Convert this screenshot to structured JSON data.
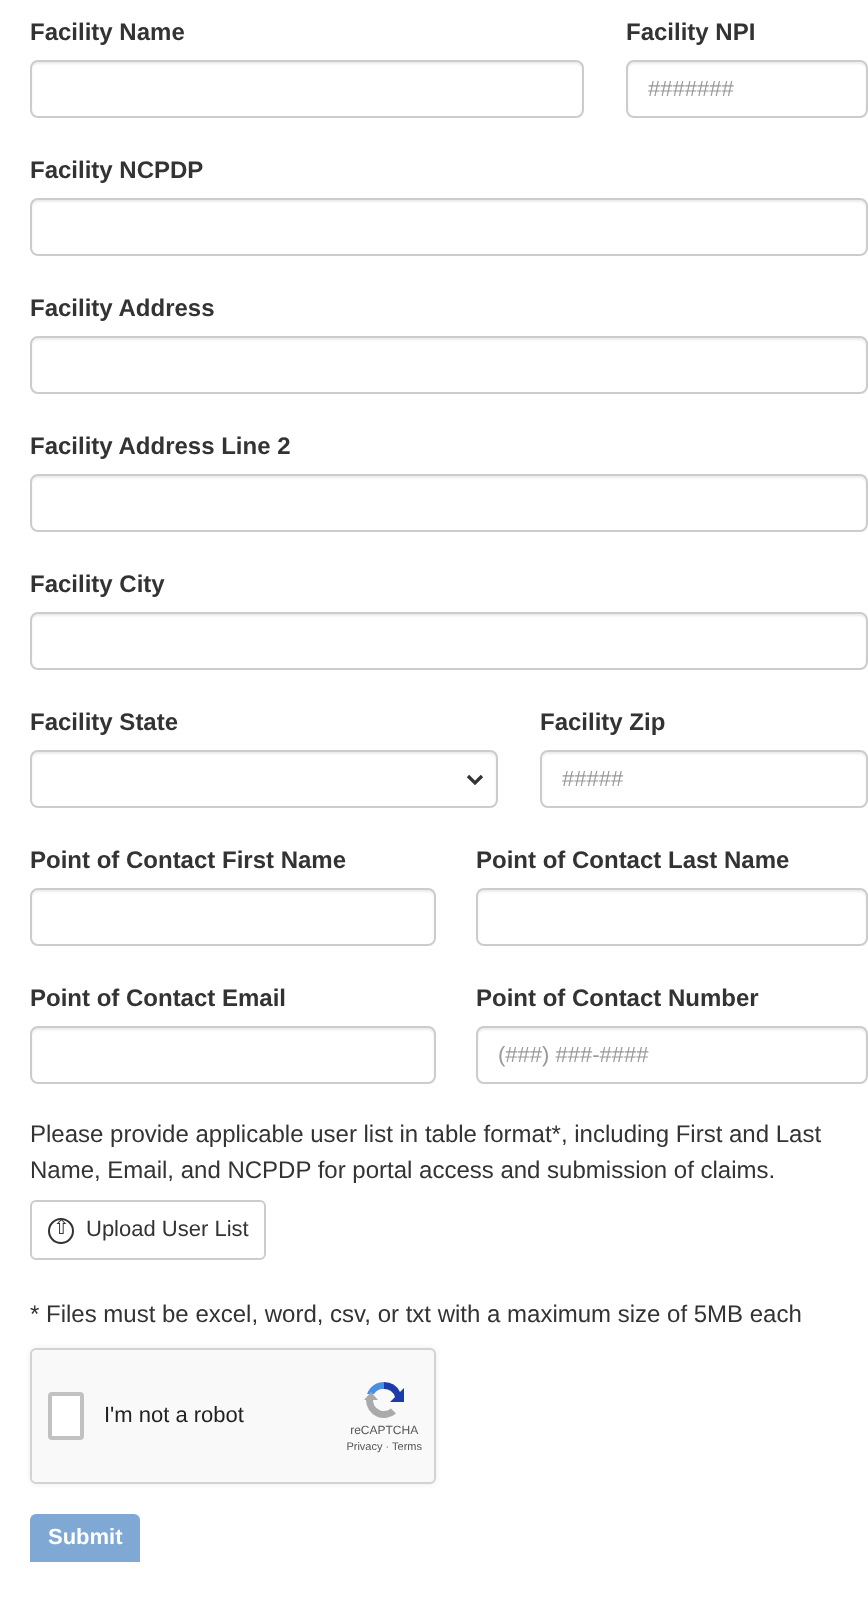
{
  "rows": [
    [
      {
        "kind": "text",
        "label": "Facility Name"
      },
      {
        "kind": "text",
        "label": "Facility NPI",
        "placeholder": "#######"
      }
    ],
    [
      {
        "kind": "text",
        "label": "Facility NCPDP"
      }
    ],
    [
      {
        "kind": "text",
        "label": "Facility Address"
      }
    ],
    [
      {
        "kind": "text",
        "label": "Facility Address Line 2"
      }
    ],
    [
      {
        "kind": "text",
        "label": "Facility City"
      }
    ],
    [
      {
        "kind": "select",
        "label": "Facility State"
      },
      {
        "kind": "text",
        "label": "Facility Zip",
        "placeholder": "#####"
      }
    ],
    [
      {
        "kind": "text",
        "label": "Point of Contact First Name"
      },
      {
        "kind": "text",
        "label": "Point of Contact Last Name"
      }
    ],
    [
      {
        "kind": "text",
        "label": "Point of Contact Email"
      },
      {
        "kind": "text",
        "label": "Point of Contact Number",
        "placeholder": "(###) ###-####"
      }
    ]
  ],
  "instructions": "Please provide applicable user list in table format*, including First and Last Name, Email, and NCPDP for portal access and submission of claims.",
  "upload_button": {
    "label": "Upload User List",
    "icon": "⇧"
  },
  "file_note": "* Files must be excel, word, csv, or txt with a maximum size of 5MB each",
  "captcha": {
    "label": "I'm not a robot",
    "checked": false,
    "brand": "reCAPTCHA",
    "links": [
      "Privacy",
      "Terms"
    ],
    "separator": "·"
  },
  "submit": {
    "label": "Submit",
    "disabled": true
  }
}
